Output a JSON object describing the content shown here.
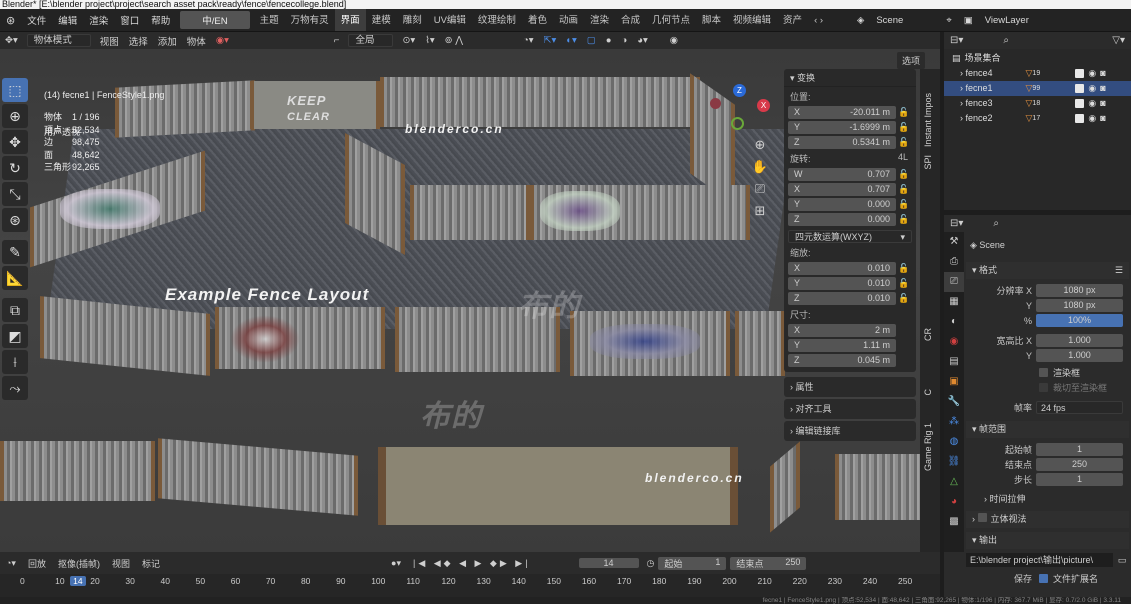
{
  "window": {
    "title": "Blender* [E:\\blender project\\project\\search asset pack\\ready\\fence\\fencecollege.blend]"
  },
  "menu": {
    "items": [
      "文件",
      "编辑",
      "渲染",
      "窗口",
      "帮助"
    ],
    "lang": "中/EN",
    "workspaces": [
      "主题",
      "万物有灵",
      "界面",
      "建模",
      "雕刻",
      "UV编辑",
      "纹理绘制",
      "着色",
      "动画",
      "渲染",
      "合成",
      "几何节点",
      "脚本",
      "视频编辑",
      "资产"
    ],
    "active_workspace": "界面",
    "scene": "Scene",
    "viewlayer": "ViewLayer"
  },
  "toolbar": {
    "mode": "物体模式",
    "items": [
      "视图",
      "选择",
      "添加",
      "物体"
    ],
    "transform": "全局",
    "options": "选项"
  },
  "viewport": {
    "view_name": "用户透视",
    "object_info": "(14) fecne1 | FenceStyle1.png",
    "stats": [
      {
        "k": "物体",
        "v": "1 / 196"
      },
      {
        "k": "顶点",
        "v": "52,534"
      },
      {
        "k": "边",
        "v": "98,475"
      },
      {
        "k": "面",
        "v": "48,642"
      },
      {
        "k": "三角形",
        "v": "92,265"
      }
    ],
    "overlay_text": "Example Fence Layout",
    "watermarks": [
      "blenderco.cn",
      "blenderco.cn",
      "布的",
      "布的"
    ],
    "graffiti_text": [
      "KEEP",
      "CLEAR"
    ]
  },
  "npanel": {
    "title": "变换",
    "location_label": "位置:",
    "location": [
      {
        "ax": "X",
        "v": "-20.011 m"
      },
      {
        "ax": "Y",
        "v": "-1.6999 m"
      },
      {
        "ax": "Z",
        "v": "0.5341 m"
      }
    ],
    "rotation_label": "旋转:",
    "rotation_mode_short": "4L",
    "rotation": [
      {
        "ax": "W",
        "v": "0.707"
      },
      {
        "ax": "X",
        "v": "0.707"
      },
      {
        "ax": "Y",
        "v": "0.000"
      },
      {
        "ax": "Z",
        "v": "0.000"
      }
    ],
    "rotation_mode": "四元数运算(WXYZ)",
    "scale_label": "缩放:",
    "scale": [
      {
        "ax": "X",
        "v": "0.010"
      },
      {
        "ax": "Y",
        "v": "0.010"
      },
      {
        "ax": "Z",
        "v": "0.010"
      }
    ],
    "dim_label": "尺寸:",
    "dims": [
      {
        "ax": "X",
        "v": "2 m"
      },
      {
        "ax": "Y",
        "v": "1.11 m"
      },
      {
        "ax": "Z",
        "v": "0.045 m"
      }
    ],
    "sections": [
      "属性",
      "对齐工具",
      "编辑链接库"
    ]
  },
  "sidetabs": [
    "Instant Impos",
    "SPI",
    "Game Rig 1",
    "C",
    "CR"
  ],
  "outliner": {
    "root": "场景集合",
    "rows": [
      {
        "name": "fence4",
        "count": "19"
      },
      {
        "name": "fecne1",
        "count": "99"
      },
      {
        "name": "fence3",
        "count": "18"
      },
      {
        "name": "fence2",
        "count": "17"
      }
    ]
  },
  "properties": {
    "scene": "Scene",
    "format_title": "格式",
    "res_x_label": "分辨率 X",
    "res_x": "1080 px",
    "res_y_label": "Y",
    "res_y": "1080 px",
    "pct_label": "%",
    "pct": "100%",
    "aspect_x_label": "宽高比 X",
    "aspect_x": "1.000",
    "aspect_y_label": "Y",
    "aspect_y": "1.000",
    "render_region": "渲染框",
    "crop": "裁切至渲染框",
    "fps_label": "帧率",
    "fps": "24 fps",
    "frame_range_title": "帧范围",
    "start_label": "起始帧",
    "start": "1",
    "end_label": "结束点",
    "end": "250",
    "step_label": "步长",
    "step": "1",
    "time_stretch": "时间拉伸",
    "stereo": "立体视法",
    "output_title": "输出",
    "output_path": "E:\\blender project\\输出\\picture\\",
    "save_label": "保存",
    "file_ext": "文件扩展名"
  },
  "timeline": {
    "items": [
      "回放",
      "抠像(插帧)",
      "视图",
      "标记"
    ],
    "current": "14",
    "start_label": "起始",
    "start": "1",
    "end_label": "结束点",
    "end": "250",
    "ruler": [
      "0",
      "10",
      "14",
      "20",
      "30",
      "40",
      "50",
      "60",
      "70",
      "80",
      "90",
      "100",
      "110",
      "120",
      "130",
      "140",
      "150",
      "160",
      "170",
      "180",
      "190",
      "200",
      "210",
      "220",
      "230",
      "240",
      "250"
    ]
  },
  "status": "fecne1 | FenceStyle1.png | 顶点:52,534 | 面:48,642 | 三角面:92,265 | 物体:1/196 | 内存: 367.7 MiB | 显存: 0.7/2.0 GiB | 3.3.11"
}
